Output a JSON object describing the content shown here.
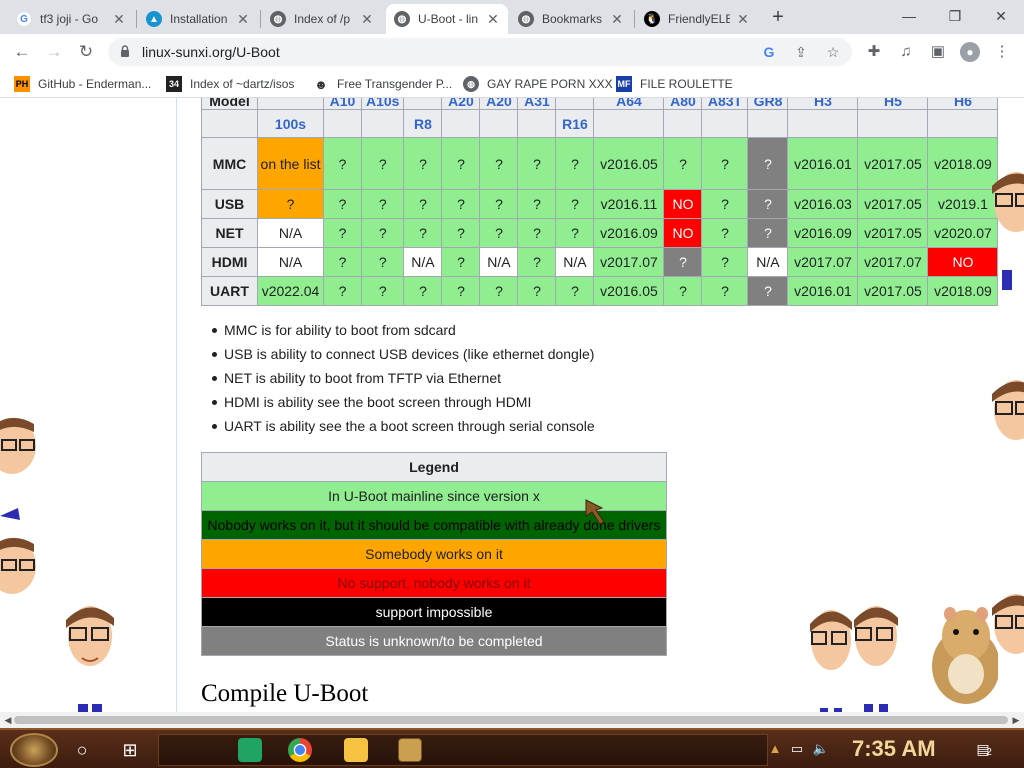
{
  "browser": {
    "tabs": [
      {
        "title": "tf3 joji - Go",
        "favicon": "google-icon"
      },
      {
        "title": "Installation",
        "favicon": "arch-icon"
      },
      {
        "title": "Index of /p",
        "favicon": "globe-icon"
      },
      {
        "title": "U-Boot - lin",
        "favicon": "globe-icon",
        "active": true
      },
      {
        "title": "Bookmarks",
        "favicon": "globe-icon"
      },
      {
        "title": "FriendlyELE",
        "favicon": "tux-icon"
      }
    ],
    "url": "linux-sunxi.org/U-Boot",
    "bookmarks": [
      {
        "label": "GitHub - Enderman...",
        "icon": "PH"
      },
      {
        "label": "Index of ~dartz/isos",
        "icon": "34"
      },
      {
        "label": "Free Transgender P...",
        "icon": "mask"
      },
      {
        "label": "GAY RAPE PORN XXX",
        "icon": "globe"
      },
      {
        "label": "FILE ROULETTE",
        "icon": "MF"
      }
    ]
  },
  "support_table": {
    "header_top": [
      "Model",
      "",
      "A10",
      "A10s",
      "",
      "A20",
      "A20",
      "A31",
      "",
      "A64",
      "A80",
      "A83T",
      "GR8",
      "H3",
      "H5",
      "H6"
    ],
    "header_bottom": [
      "",
      "100s",
      "",
      "",
      "R8",
      "",
      "",
      "",
      "R16",
      "",
      "",
      "",
      "",
      "",
      "",
      ""
    ],
    "rows": [
      {
        "label": "MMC",
        "cells": [
          {
            "v": "on the list",
            "s": "wip"
          },
          {
            "v": "?",
            "s": "ok"
          },
          {
            "v": "?",
            "s": "ok"
          },
          {
            "v": "?",
            "s": "ok"
          },
          {
            "v": "?",
            "s": "ok"
          },
          {
            "v": "?",
            "s": "ok"
          },
          {
            "v": "?",
            "s": "ok"
          },
          {
            "v": "?",
            "s": "ok"
          },
          {
            "v": "v2016.05",
            "s": "ok"
          },
          {
            "v": "?",
            "s": "ok"
          },
          {
            "v": "?",
            "s": "ok"
          },
          {
            "v": "?",
            "s": "unk"
          },
          {
            "v": "v2016.01",
            "s": "ok"
          },
          {
            "v": "v2017.05",
            "s": "ok"
          },
          {
            "v": "v2018.09",
            "s": "ok"
          }
        ]
      },
      {
        "label": "USB",
        "cells": [
          {
            "v": "?",
            "s": "wip"
          },
          {
            "v": "?",
            "s": "ok"
          },
          {
            "v": "?",
            "s": "ok"
          },
          {
            "v": "?",
            "s": "ok"
          },
          {
            "v": "?",
            "s": "ok"
          },
          {
            "v": "?",
            "s": "ok"
          },
          {
            "v": "?",
            "s": "ok"
          },
          {
            "v": "?",
            "s": "ok"
          },
          {
            "v": "v2016.11",
            "s": "ok"
          },
          {
            "v": "NO",
            "s": "no"
          },
          {
            "v": "?",
            "s": "ok"
          },
          {
            "v": "?",
            "s": "unk"
          },
          {
            "v": "v2016.03",
            "s": "ok"
          },
          {
            "v": "v2017.05",
            "s": "ok"
          },
          {
            "v": "v2019.1",
            "s": "ok"
          }
        ]
      },
      {
        "label": "NET",
        "cells": [
          {
            "v": "N/A",
            "s": "na"
          },
          {
            "v": "?",
            "s": "ok"
          },
          {
            "v": "?",
            "s": "ok"
          },
          {
            "v": "?",
            "s": "ok"
          },
          {
            "v": "?",
            "s": "ok"
          },
          {
            "v": "?",
            "s": "ok"
          },
          {
            "v": "?",
            "s": "ok"
          },
          {
            "v": "?",
            "s": "ok"
          },
          {
            "v": "v2016.09",
            "s": "ok"
          },
          {
            "v": "NO",
            "s": "no"
          },
          {
            "v": "?",
            "s": "ok"
          },
          {
            "v": "?",
            "s": "unk"
          },
          {
            "v": "v2016.09",
            "s": "ok"
          },
          {
            "v": "v2017.05",
            "s": "ok"
          },
          {
            "v": "v2020.07",
            "s": "ok"
          }
        ]
      },
      {
        "label": "HDMI",
        "cells": [
          {
            "v": "N/A",
            "s": "na"
          },
          {
            "v": "?",
            "s": "ok"
          },
          {
            "v": "?",
            "s": "ok"
          },
          {
            "v": "N/A",
            "s": "na"
          },
          {
            "v": "?",
            "s": "ok"
          },
          {
            "v": "N/A",
            "s": "na"
          },
          {
            "v": "?",
            "s": "ok"
          },
          {
            "v": "N/A",
            "s": "na"
          },
          {
            "v": "v2017.07",
            "s": "ok"
          },
          {
            "v": "?",
            "s": "unk"
          },
          {
            "v": "?",
            "s": "ok"
          },
          {
            "v": "N/A",
            "s": "na"
          },
          {
            "v": "v2017.07",
            "s": "ok"
          },
          {
            "v": "v2017.07",
            "s": "ok"
          },
          {
            "v": "NO",
            "s": "no"
          }
        ]
      },
      {
        "label": "UART",
        "cells": [
          {
            "v": "v2022.04",
            "s": "ok"
          },
          {
            "v": "?",
            "s": "ok"
          },
          {
            "v": "?",
            "s": "ok"
          },
          {
            "v": "?",
            "s": "ok"
          },
          {
            "v": "?",
            "s": "ok"
          },
          {
            "v": "?",
            "s": "ok"
          },
          {
            "v": "?",
            "s": "ok"
          },
          {
            "v": "?",
            "s": "ok"
          },
          {
            "v": "v2016.05",
            "s": "ok"
          },
          {
            "v": "?",
            "s": "ok"
          },
          {
            "v": "?",
            "s": "ok"
          },
          {
            "v": "?",
            "s": "unk"
          },
          {
            "v": "v2016.01",
            "s": "ok"
          },
          {
            "v": "v2017.05",
            "s": "ok"
          },
          {
            "v": "v2018.09",
            "s": "ok"
          }
        ]
      }
    ]
  },
  "notes": [
    "MMC is for ability to boot from sdcard",
    "USB is ability to connect USB devices (like ethernet dongle)",
    "NET is ability to boot from TFTP via Ethernet",
    "HDMI is ability see the boot screen through HDMI",
    "UART is ability see the a boot screen through serial console"
  ],
  "legend": {
    "title": "Legend",
    "items": [
      {
        "label": "In U-Boot mainline since version x",
        "bg": "#90ee90",
        "fg": "#202122"
      },
      {
        "label": "Nobody works on it, but it should be compatible with already done drivers",
        "bg": "#006400",
        "fg": "#000000"
      },
      {
        "label": "Somebody works on it",
        "bg": "#ffa500",
        "fg": "#202122"
      },
      {
        "label": "No support, nobody works on it",
        "bg": "#ff0000",
        "fg": "#800000"
      },
      {
        "label": "support impossible",
        "bg": "#000000",
        "fg": "#ffffff"
      },
      {
        "label": "Status is unknown/to be completed",
        "bg": "#808080",
        "fg": "#ffffff"
      }
    ]
  },
  "section_heading": "Compile U-Boot",
  "taskbar": {
    "clock": "7:35 AM",
    "notification_count": "2"
  },
  "colors": {
    "ok": "#90ee90",
    "wip": "#ffa500",
    "no": "#ff0000",
    "unknown": "#808080",
    "na": "#ffffff"
  }
}
